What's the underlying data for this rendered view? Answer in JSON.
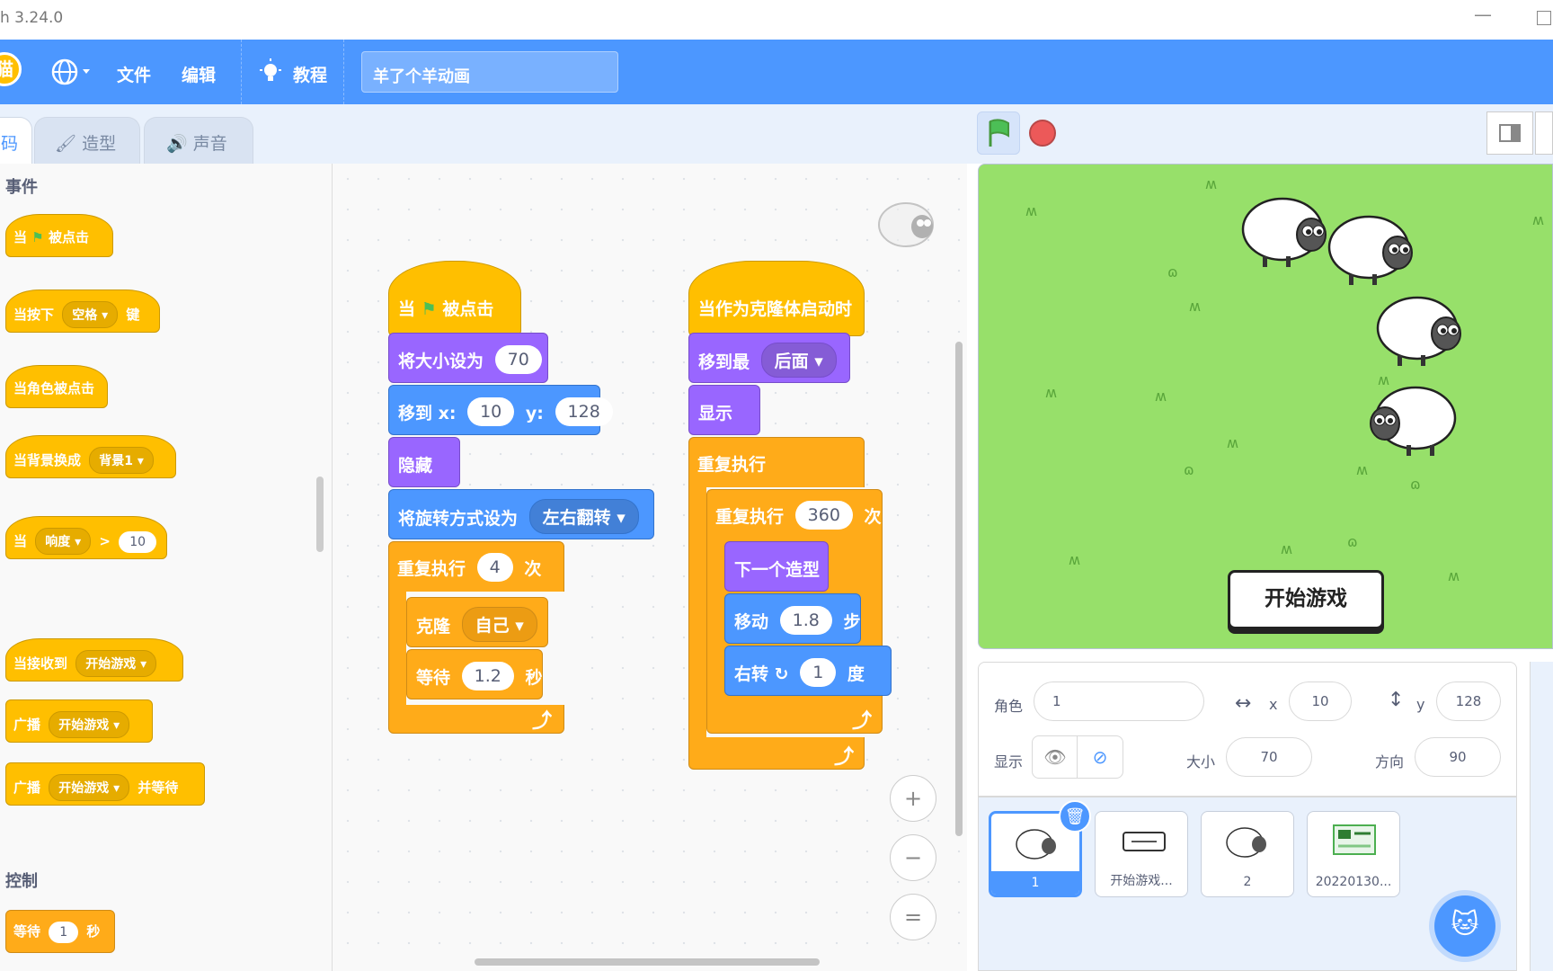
{
  "window": {
    "title": "h 3.24.0"
  },
  "menubar": {
    "file": "文件",
    "edit": "编辑",
    "tutorial": "教程",
    "project_title": "羊了个羊动画",
    "logo": "猫"
  },
  "tabs": {
    "code": "码",
    "costumes": "造型",
    "sounds": "声音"
  },
  "palette": {
    "category_events": "事件",
    "category_control": "控制",
    "when": "当",
    "clicked": "被点击",
    "when_key": "当按下",
    "key_value": "空格",
    "key_suffix": "键",
    "when_sprite_clicked": "当角色被点击",
    "when_backdrop": "当背景换成",
    "backdrop_value": "背景1",
    "loudness": "响度",
    "gt": ">",
    "loud_value": "10",
    "when_receive": "当接收到",
    "msg_value": "开始游戏",
    "broadcast": "广播",
    "and_wait": "并等待",
    "wait": "等待",
    "wait_value": "1",
    "seconds": "秒"
  },
  "script1": {
    "when": "当",
    "clicked": "被点击",
    "set_size": "将大小设为",
    "size_value": "70",
    "goto_x": "移到 x:",
    "x_value": "10",
    "y_label": "y:",
    "y_value": "128",
    "hide": "隐藏",
    "rotation": "将旋转方式设为",
    "rotation_value": "左右翻转",
    "repeat": "重复执行",
    "repeat_value": "4",
    "times": "次",
    "clone": "克隆",
    "clone_value": "自己",
    "wait": "等待",
    "wait_value": "1.2",
    "seconds": "秒"
  },
  "script2": {
    "hat": "当作为克隆体启动时",
    "goto_layer": "移到最",
    "layer_value": "后面",
    "show": "显示",
    "forever": "重复执行",
    "repeat": "重复执行",
    "repeat_value": "360",
    "times": "次",
    "next_costume": "下一个造型",
    "move": "移动",
    "move_value": "1.8",
    "steps": "步",
    "turn": "右转",
    "turn_value": "1",
    "degrees": "度"
  },
  "zoom": {
    "in": "+",
    "out": "−",
    "reset": "="
  },
  "stage": {
    "start_button": "开始游戏"
  },
  "sprite_info": {
    "sprite_label": "角色",
    "sprite_name": "1",
    "x_label": "x",
    "x_value": "10",
    "y_label": "y",
    "y_value": "128",
    "show_label": "显示",
    "size_label": "大小",
    "size_value": "70",
    "direction_label": "方向",
    "direction_value": "90"
  },
  "sprites": [
    {
      "name": "1"
    },
    {
      "name": "开始游戏..."
    },
    {
      "name": "2"
    },
    {
      "name": "20220130..."
    }
  ],
  "colors": {
    "accent": "#4c97ff",
    "events": "#ffbf00",
    "control": "#ffab19",
    "looks": "#9966ff",
    "motion": "#4c97ff",
    "stage_bg": "#97e06a"
  }
}
